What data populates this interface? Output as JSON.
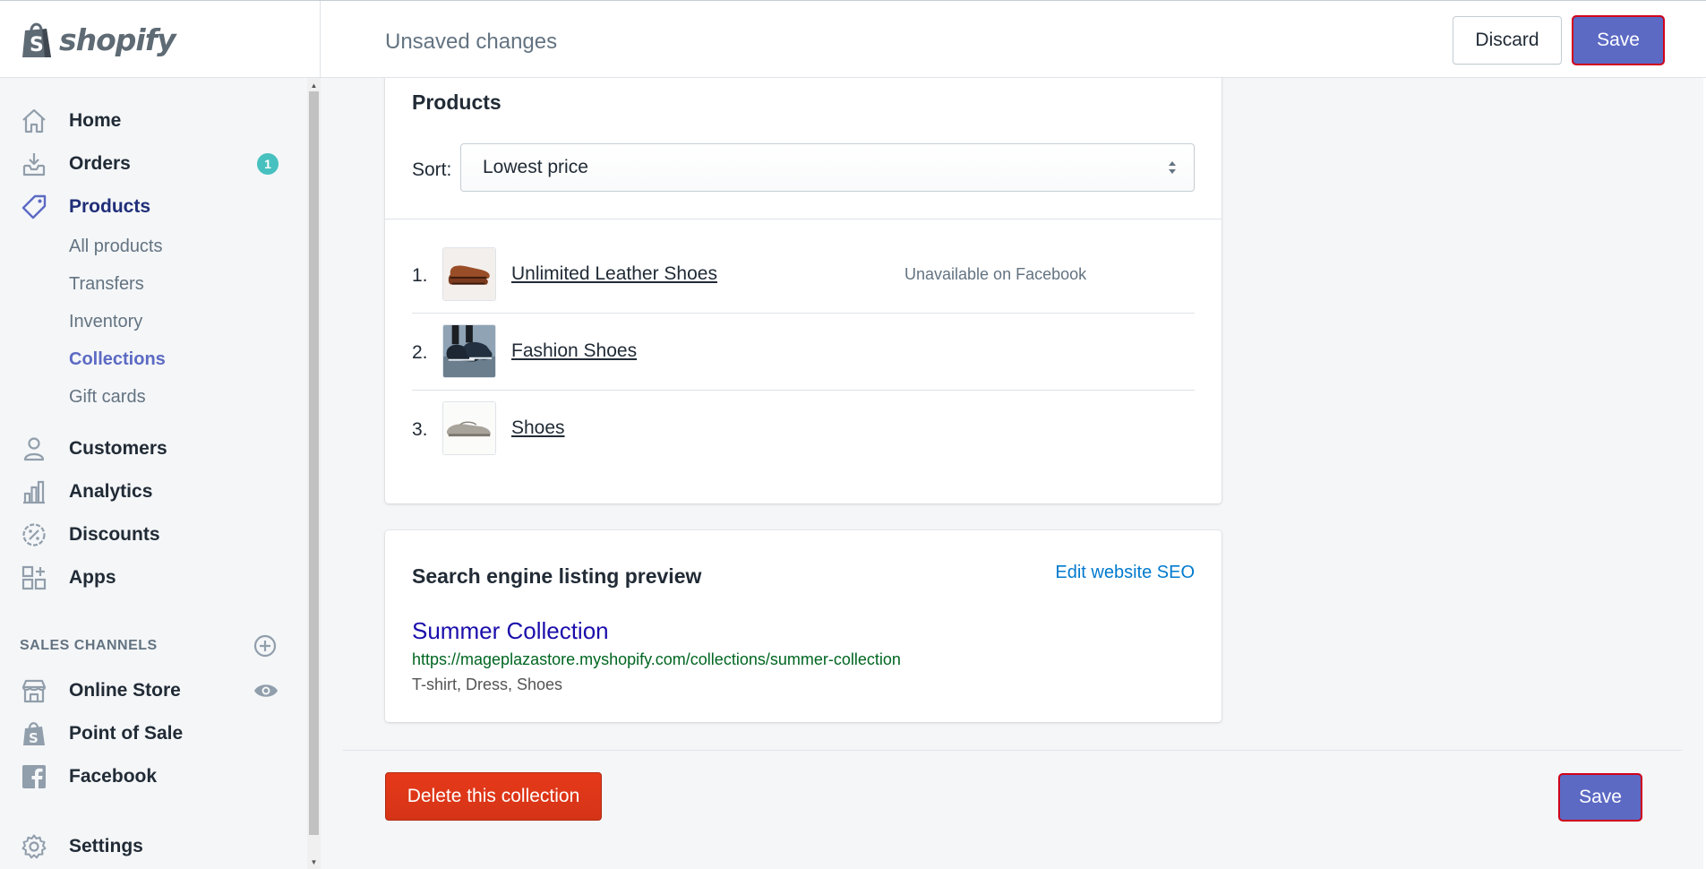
{
  "app": {
    "brand": "shopify",
    "accent": "#5c6ac4",
    "danger": "#de3618"
  },
  "topbar": {
    "status": "Unsaved changes",
    "discard_label": "Discard",
    "save_label": "Save"
  },
  "sidebar": {
    "items": [
      {
        "label": "Home",
        "icon": "home-icon"
      },
      {
        "label": "Orders",
        "icon": "orders-icon",
        "badge": "1"
      },
      {
        "label": "Products",
        "icon": "tag-icon",
        "active": true
      },
      {
        "label": "Customers",
        "icon": "person-icon"
      },
      {
        "label": "Analytics",
        "icon": "bar-chart-icon"
      },
      {
        "label": "Discounts",
        "icon": "discount-icon"
      },
      {
        "label": "Apps",
        "icon": "apps-icon"
      }
    ],
    "product_subitems": [
      "All products",
      "Transfers",
      "Inventory",
      "Collections",
      "Gift cards"
    ],
    "active_subitem": "Collections",
    "sales_channels_title": "SALES CHANNELS",
    "channels": [
      {
        "label": "Online Store",
        "icon": "store-icon"
      },
      {
        "label": "Point of Sale",
        "icon": "shopify-bag-icon"
      },
      {
        "label": "Facebook",
        "icon": "facebook-icon"
      }
    ],
    "settings_label": "Settings"
  },
  "products_card": {
    "title": "Products",
    "sort_label": "Sort:",
    "sort_value": "Lowest price",
    "rows": [
      {
        "num": "1.",
        "name": "Unlimited Leather Shoes",
        "note": "Unavailable on Facebook"
      },
      {
        "num": "2.",
        "name": "Fashion Shoes",
        "note": ""
      },
      {
        "num": "3.",
        "name": "Shoes",
        "note": ""
      }
    ]
  },
  "seo": {
    "title": "Search engine listing preview",
    "edit_link": "Edit website SEO",
    "page_title": "Summer Collection",
    "url": "https://mageplazastore.myshopify.com/collections/summer-collection",
    "description": "T-shirt, Dress, Shoes"
  },
  "footer": {
    "delete_label": "Delete this collection",
    "save_label": "Save"
  }
}
